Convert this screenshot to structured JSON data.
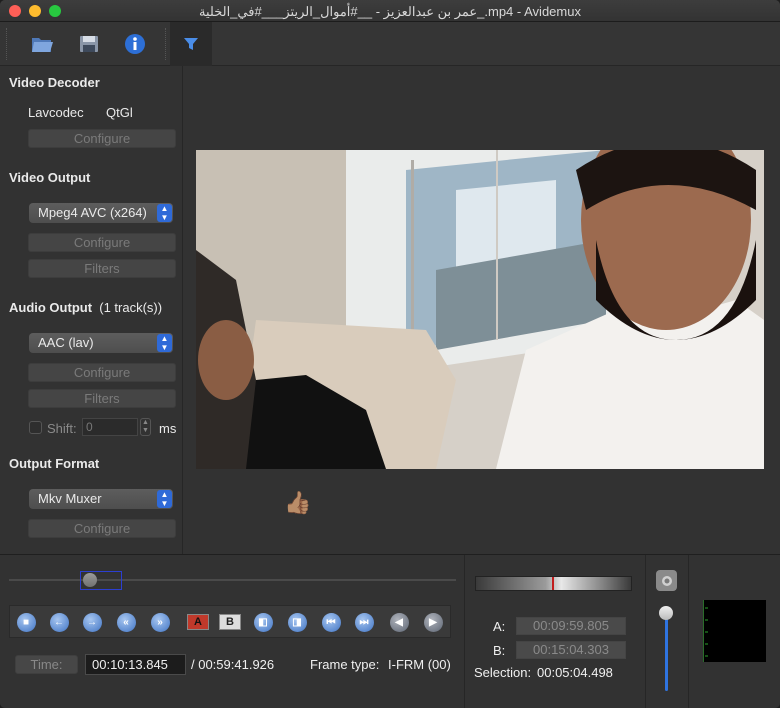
{
  "window": {
    "title": "عمر بن عبدالعزيز - __#أموال_الريتز___#في_الخلية_.mp4 - Avidemux"
  },
  "toolbar": {
    "icons": [
      "open-folder-icon",
      "save-disk-icon",
      "info-icon",
      "filter-icon"
    ]
  },
  "video_decoder": {
    "heading": "Video Decoder",
    "lavcodec": "Lavcodec",
    "qtgl": "QtGl",
    "configure": "Configure"
  },
  "video_output": {
    "heading": "Video Output",
    "selected": "Mpeg4 AVC (x264)",
    "configure": "Configure",
    "filters": "Filters"
  },
  "audio_output": {
    "heading": "Audio Output",
    "tracks": "(1 track(s))",
    "selected": "AAC (lav)",
    "configure": "Configure",
    "filters": "Filters",
    "shift_label": "Shift:",
    "shift_value": "0",
    "shift_unit": "ms"
  },
  "output_format": {
    "heading": "Output Format",
    "selected": "Mkv Muxer",
    "configure": "Configure"
  },
  "emoji": "👍🏽",
  "navigation": {
    "time_button": "Time:",
    "current_time": "00:10:13.845",
    "total_time": "/ 00:59:41.926",
    "frame_type_label": "Frame type:",
    "frame_type_value": "I-FRM (00)",
    "playback_position": 0.171
  },
  "selection": {
    "a_label": "A:",
    "a_value": "00:09:59.805",
    "b_label": "B:",
    "b_value": "00:15:04.303",
    "selection_label": "Selection:",
    "selection_value": "00:05:04.498"
  },
  "nav_buttons": [
    "stop",
    "previous",
    "next",
    "rewind",
    "forward",
    "set-marker-a",
    "set-marker-b",
    "go-to-marker-a",
    "go-to-marker-b",
    "first-frame",
    "last-frame",
    "prev-black",
    "next-black"
  ],
  "colors": {
    "accent": "#2f6ad8",
    "window_bg": "#323232",
    "marker": "#c21d1d"
  }
}
